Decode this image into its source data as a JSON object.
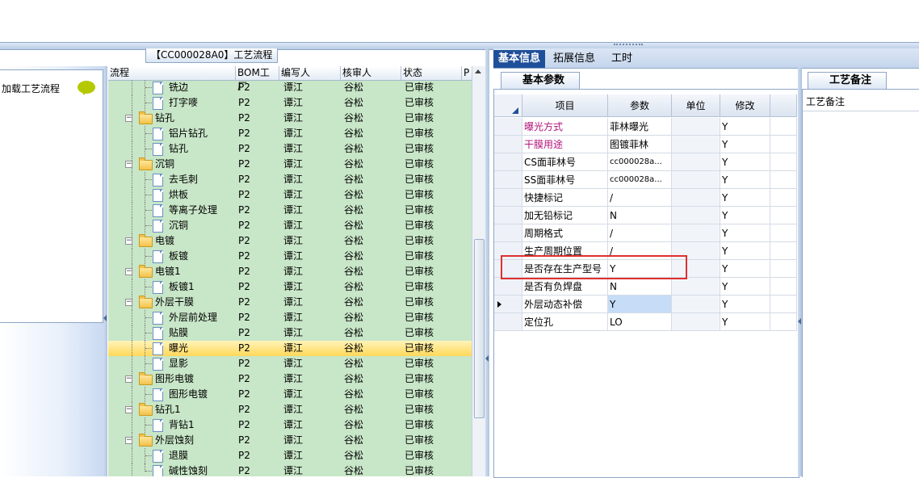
{
  "window": {
    "tree_title": "【CC000028A0】工艺流程",
    "left_item_label": "加载工艺流程"
  },
  "tree": {
    "columns": [
      "流程",
      "BOM工厂",
      "编写人",
      "核审人",
      "状态",
      "P"
    ],
    "rows": [
      {
        "level": 2,
        "type": "doc",
        "name": "铣边",
        "bom": "P2",
        "writer": "谭江",
        "reviewer": "谷松",
        "status": "已审核"
      },
      {
        "level": 2,
        "type": "doc",
        "name": "打字嘜",
        "bom": "P2",
        "writer": "谭江",
        "reviewer": "谷松",
        "status": "已审核"
      },
      {
        "level": 1,
        "type": "folder",
        "name": "钻孔",
        "bom": "P2",
        "writer": "谭江",
        "reviewer": "谷松",
        "status": "已审核"
      },
      {
        "level": 2,
        "type": "doc",
        "name": "铝片钻孔",
        "bom": "P2",
        "writer": "谭江",
        "reviewer": "谷松",
        "status": "已审核"
      },
      {
        "level": 2,
        "type": "doc",
        "name": "钻孔",
        "bom": "P2",
        "writer": "谭江",
        "reviewer": "谷松",
        "status": "已审核"
      },
      {
        "level": 1,
        "type": "folder",
        "name": "沉铜",
        "bom": "P2",
        "writer": "谭江",
        "reviewer": "谷松",
        "status": "已审核"
      },
      {
        "level": 2,
        "type": "doc",
        "name": "去毛刺",
        "bom": "P2",
        "writer": "谭江",
        "reviewer": "谷松",
        "status": "已审核"
      },
      {
        "level": 2,
        "type": "doc",
        "name": "烘板",
        "bom": "P2",
        "writer": "谭江",
        "reviewer": "谷松",
        "status": "已审核"
      },
      {
        "level": 2,
        "type": "doc",
        "name": "等离子处理",
        "bom": "P2",
        "writer": "谭江",
        "reviewer": "谷松",
        "status": "已审核"
      },
      {
        "level": 2,
        "type": "doc",
        "name": "沉铜",
        "bom": "P2",
        "writer": "谭江",
        "reviewer": "谷松",
        "status": "已审核"
      },
      {
        "level": 1,
        "type": "folder",
        "name": "电镀",
        "bom": "P2",
        "writer": "谭江",
        "reviewer": "谷松",
        "status": "已审核"
      },
      {
        "level": 2,
        "type": "doc",
        "name": "板镀",
        "bom": "P2",
        "writer": "谭江",
        "reviewer": "谷松",
        "status": "已审核"
      },
      {
        "level": 1,
        "type": "folder",
        "name": "电镀1",
        "bom": "P2",
        "writer": "谭江",
        "reviewer": "谷松",
        "status": "已审核"
      },
      {
        "level": 2,
        "type": "doc",
        "name": "板镀1",
        "bom": "P2",
        "writer": "谭江",
        "reviewer": "谷松",
        "status": "已审核"
      },
      {
        "level": 1,
        "type": "folder",
        "name": "外层干膜",
        "bom": "P2",
        "writer": "谭江",
        "reviewer": "谷松",
        "status": "已审核"
      },
      {
        "level": 2,
        "type": "doc",
        "name": "外层前处理",
        "bom": "P2",
        "writer": "谭江",
        "reviewer": "谷松",
        "status": "已审核"
      },
      {
        "level": 2,
        "type": "doc",
        "name": "贴膜",
        "bom": "P2",
        "writer": "谭江",
        "reviewer": "谷松",
        "status": "已审核"
      },
      {
        "level": 2,
        "type": "doc",
        "name": "曝光",
        "bom": "P2",
        "writer": "谭江",
        "reviewer": "谷松",
        "status": "已审核",
        "selected": true
      },
      {
        "level": 2,
        "type": "doc",
        "name": "显影",
        "bom": "P2",
        "writer": "谭江",
        "reviewer": "谷松",
        "status": "已审核"
      },
      {
        "level": 1,
        "type": "folder",
        "name": "图形电镀",
        "bom": "P2",
        "writer": "谭江",
        "reviewer": "谷松",
        "status": "已审核"
      },
      {
        "level": 2,
        "type": "doc",
        "name": "图形电镀",
        "bom": "P2",
        "writer": "谭江",
        "reviewer": "谷松",
        "status": "已审核"
      },
      {
        "level": 1,
        "type": "folder",
        "name": "钻孔1",
        "bom": "P2",
        "writer": "谭江",
        "reviewer": "谷松",
        "status": "已审核"
      },
      {
        "level": 2,
        "type": "doc",
        "name": "背钻1",
        "bom": "P2",
        "writer": "谭江",
        "reviewer": "谷松",
        "status": "已审核"
      },
      {
        "level": 1,
        "type": "folder",
        "name": "外层蚀刻",
        "bom": "P2",
        "writer": "谭江",
        "reviewer": "谷松",
        "status": "已审核"
      },
      {
        "level": 2,
        "type": "doc",
        "name": "退膜",
        "bom": "P2",
        "writer": "谭江",
        "reviewer": "谷松",
        "status": "已审核"
      },
      {
        "level": 2,
        "type": "doc",
        "name": "碱性蚀刻",
        "bom": "P2",
        "writer": "谭江",
        "reviewer": "谷松",
        "status": "已审核"
      }
    ]
  },
  "right": {
    "tabs": [
      "基本信息",
      "拓展信息",
      "工时"
    ],
    "sub_tab": "基本参数",
    "grid_headers": [
      "项目",
      "参数",
      "单位",
      "修改"
    ],
    "grid_rows": [
      {
        "item": "曝光方式",
        "param": "菲林曝光",
        "unit": "",
        "mod": "Y",
        "highlight": true
      },
      {
        "item": "干膜用途",
        "param": "图镀菲林",
        "unit": "",
        "mod": "Y",
        "highlight": true
      },
      {
        "item": "CS面菲林号",
        "param": "cc000028a...",
        "unit": "",
        "mod": "Y"
      },
      {
        "item": "SS面菲林号",
        "param": "cc000028a...",
        "unit": "",
        "mod": "Y"
      },
      {
        "item": "快捷标记",
        "param": "/",
        "unit": "",
        "mod": "Y"
      },
      {
        "item": "加无铅标记",
        "param": "N",
        "unit": "",
        "mod": "Y"
      },
      {
        "item": "周期格式",
        "param": "/",
        "unit": "",
        "mod": "Y"
      },
      {
        "item": "生产周期位置",
        "param": "/",
        "unit": "",
        "mod": "Y"
      },
      {
        "item": "是否存在生产型号",
        "param": "Y",
        "unit": "",
        "mod": "Y"
      },
      {
        "item": "是否有负焊盘",
        "param": "N",
        "unit": "",
        "mod": "Y"
      },
      {
        "item": "外层动态补偿",
        "param": "Y",
        "unit": "",
        "mod": "Y",
        "current": true
      },
      {
        "item": "定位孔",
        "param": "LO",
        "unit": "",
        "mod": "Y"
      }
    ],
    "notes_tab": "工艺备注",
    "notes_label": "工艺备注"
  },
  "colors": {
    "tree_bg": "#c8e6c8",
    "selected_row": "#ffd85a",
    "active_tab": "#1f4f9a",
    "highlight_text": "#b0137a",
    "annotation_box": "#e03030"
  }
}
